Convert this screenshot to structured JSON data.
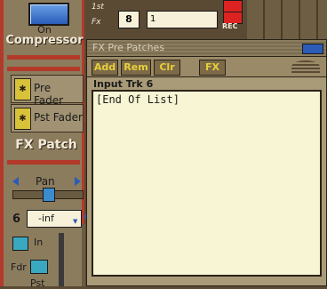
{
  "compressor": {
    "on_label": "On",
    "title": "Compressor"
  },
  "fader_buttons": [
    {
      "icon": "fx-icon",
      "label": "Pre Fader"
    },
    {
      "icon": "fx-icon",
      "label": "Pst Fader"
    }
  ],
  "fx_patch_label": "FX Patch",
  "pan": {
    "label": "Pan",
    "level": 0.5
  },
  "track": {
    "number": "6",
    "volume": "-inf"
  },
  "input_toggle_label": "In",
  "fdr_label": "Fdr",
  "pst_label": "Pst",
  "top_track": {
    "labels": [
      "1st",
      "Fx"
    ],
    "number": "8",
    "name": "1",
    "rec_label": "REC"
  },
  "fx_window": {
    "title": "FX Pre Patches",
    "toolbar": {
      "add": "Add",
      "rem": "Rem",
      "clr": "Clr",
      "fx": "FX"
    },
    "input_label": "Input Trk 6",
    "list_items": [
      "[End Of List]"
    ]
  },
  "colors": {
    "accent_red": "#b23a2a",
    "button_blue": "#2a5cb8",
    "list_bg": "#f8f5d4",
    "toolbar_text": "#e8cf3a"
  }
}
